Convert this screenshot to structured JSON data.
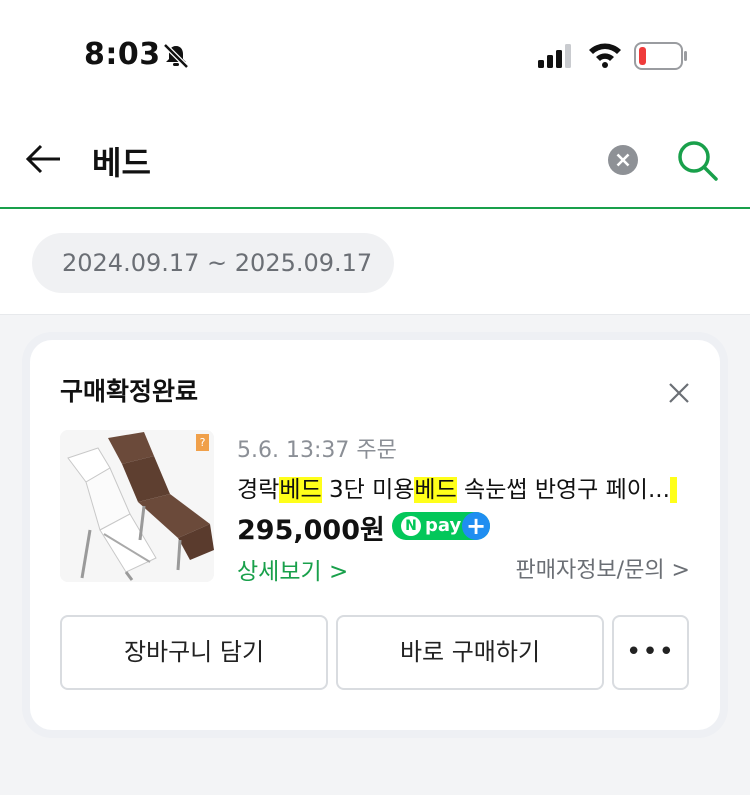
{
  "status": {
    "time": "8:03"
  },
  "search": {
    "query": "베드"
  },
  "filter": {
    "date_range": "2024.09.17 ~ 2025.09.17"
  },
  "order": {
    "status": "구매확정완료",
    "order_date": "5.6. 13:37 주문",
    "product_parts": [
      "경락",
      "베드",
      " 3단 미용",
      "베드",
      " 속눈썹 반영구 페이..."
    ],
    "price": "295,000원",
    "pay_badge": "pay",
    "pay_n": "N",
    "pay_plus": "+",
    "detail_link": "상세보기 >",
    "seller_link": "판매자정보/문의 >",
    "cart_button": "장바구니 담기",
    "buy_button": "바로 구매하기",
    "more_button": "•••",
    "badge": "?"
  }
}
